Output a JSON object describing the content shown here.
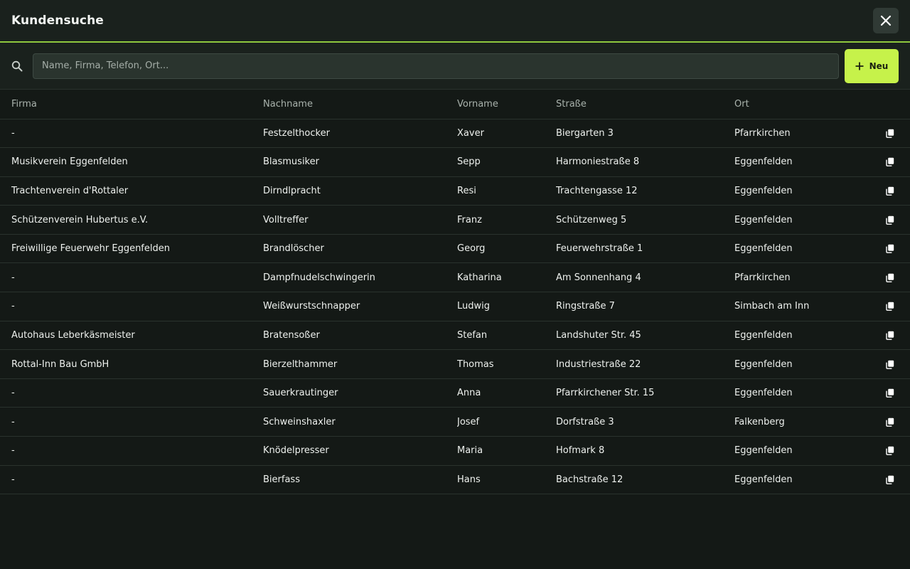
{
  "header": {
    "title": "Kundensuche",
    "close_icon": "close-icon"
  },
  "toolbar": {
    "search_placeholder": "Name, Firma, Telefon, Ort...",
    "search_value": "",
    "search_icon": "search-icon",
    "new_label": "Neu",
    "new_icon": "plus-icon"
  },
  "table": {
    "columns": [
      "Firma",
      "Nachname",
      "Vorname",
      "Straße",
      "Ort"
    ],
    "row_action_icon": "copy-icon",
    "rows": [
      [
        "-",
        "Festzelthocker",
        "Xaver",
        "Biergarten 3",
        "Pfarrkirchen"
      ],
      [
        "Musikverein Eggenfelden",
        "Blasmusiker",
        "Sepp",
        "Harmoniestraße 8",
        "Eggenfelden"
      ],
      [
        "Trachtenverein d'Rottaler",
        "Dirndlpracht",
        "Resi",
        "Trachtengasse 12",
        "Eggenfelden"
      ],
      [
        "Schützenverein Hubertus e.V.",
        "Volltreffer",
        "Franz",
        "Schützenweg 5",
        "Eggenfelden"
      ],
      [
        "Freiwillige Feuerwehr Eggenfelden",
        "Brandlöscher",
        "Georg",
        "Feuerwehrstraße 1",
        "Eggenfelden"
      ],
      [
        "-",
        "Dampfnudelschwingerin",
        "Katharina",
        "Am Sonnenhang 4",
        "Pfarrkirchen"
      ],
      [
        "-",
        "Weißwurstschnapper",
        "Ludwig",
        "Ringstraße 7",
        "Simbach am Inn"
      ],
      [
        "Autohaus Leberkäsmeister",
        "Bratensoßer",
        "Stefan",
        "Landshuter Str. 45",
        "Eggenfelden"
      ],
      [
        "Rottal-Inn Bau GmbH",
        "Bierzelthammer",
        "Thomas",
        "Industriestraße 22",
        "Eggenfelden"
      ],
      [
        "-",
        "Sauerkrautinger",
        "Anna",
        "Pfarrkirchener Str. 15",
        "Eggenfelden"
      ],
      [
        "-",
        "Schweinshaxler",
        "Josef",
        "Dorfstraße 3",
        "Falkenberg"
      ],
      [
        "-",
        "Knödelpresser",
        "Maria",
        "Hofmark 8",
        "Eggenfelden"
      ],
      [
        "-",
        "Bierfass",
        "Hans",
        "Bachstraße 12",
        "Eggenfelden"
      ]
    ]
  },
  "colors": {
    "accent": "#c6f24a",
    "header_border": "#8fc73e",
    "background": "#141916",
    "panel": "#1a211d"
  }
}
